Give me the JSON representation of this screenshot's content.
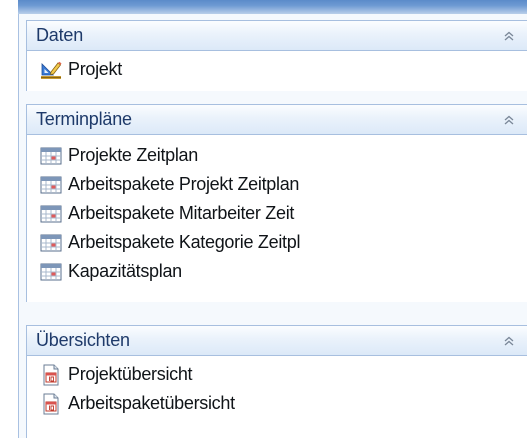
{
  "groups": [
    {
      "title": "Daten",
      "items": [
        {
          "label": "Projekt",
          "icon": "project-icon"
        }
      ]
    },
    {
      "title": "Terminpläne",
      "items": [
        {
          "label": "Projekte Zeitplan",
          "icon": "calendar-grid-icon"
        },
        {
          "label": "Arbeitspakete Projekt Zeitplan",
          "icon": "calendar-grid-icon"
        },
        {
          "label": "Arbeitspakete Mitarbeiter Zeit",
          "icon": "calendar-grid-icon"
        },
        {
          "label": "Arbeitspakete Kategorie Zeitpl",
          "icon": "calendar-grid-icon"
        },
        {
          "label": "Kapazitätsplan",
          "icon": "calendar-grid-icon"
        }
      ]
    },
    {
      "title": "Übersichten",
      "items": [
        {
          "label": "Projektübersicht",
          "icon": "report-icon"
        },
        {
          "label": "Arbeitspaketübersicht",
          "icon": "report-icon"
        }
      ]
    }
  ],
  "colors": {
    "header_text": "#1e3a6a",
    "header_border": "#a7bfdf",
    "item_text": "#101418",
    "top_edge": "#5b8bc9"
  }
}
